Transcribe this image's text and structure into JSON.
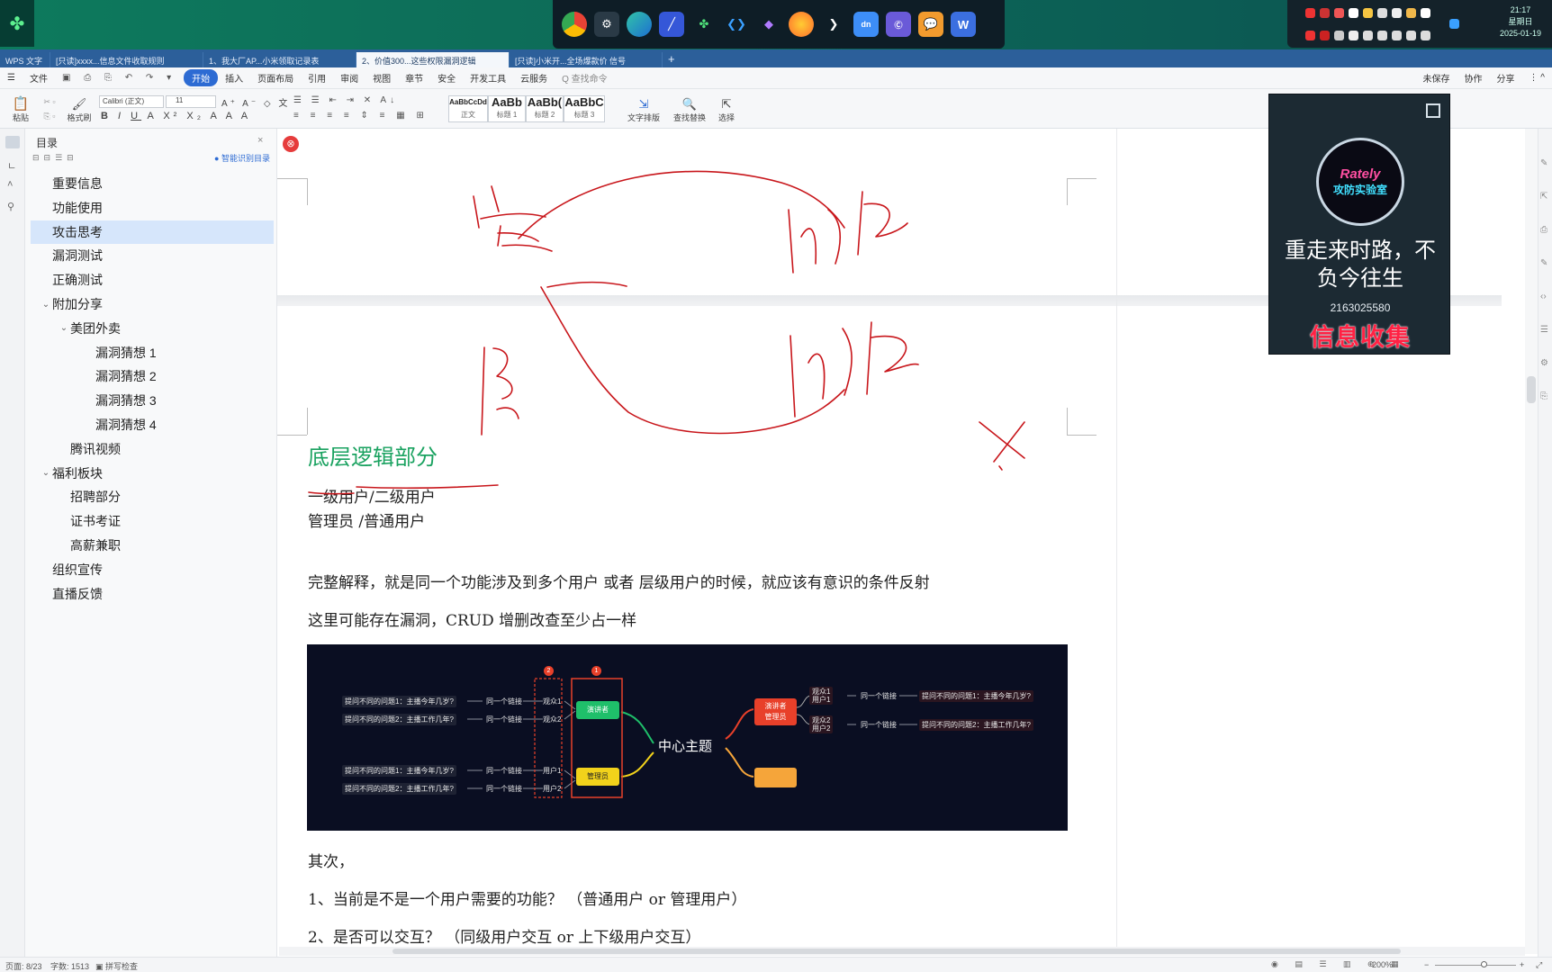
{
  "taskbar": {
    "clock_time": "21:17",
    "clock_weekday": "星期日",
    "clock_date": "2025-01-19"
  },
  "window_tabs": [
    {
      "label": "WPS 文字"
    },
    {
      "label": "[只读]xxxx...信息文件收取规则"
    },
    {
      "label": "1、我大厂AP...小米领取记录表"
    },
    {
      "label": "2、价值300...这些权限漏洞逻辑"
    },
    {
      "label": "[只读]小米开...全场爆款价 信号"
    }
  ],
  "menu": {
    "items": [
      "文件",
      "开始",
      "插入",
      "页面布局",
      "引用",
      "审阅",
      "视图",
      "章节",
      "安全",
      "开发工具",
      "云服务",
      "Q 查找命令"
    ],
    "right": [
      "未保存",
      "协作",
      "分享"
    ]
  },
  "ribbon": {
    "paste": "粘贴",
    "format_painter": "格式刷",
    "font_name": "Calibri (正文)",
    "font_size": "11",
    "styles": [
      {
        "sample": "AaBbCcDd",
        "name": "正文"
      },
      {
        "sample": "AaBb",
        "name": "标题 1"
      },
      {
        "sample": "AaBb(",
        "name": "标题 2"
      },
      {
        "sample": "AaBbC",
        "name": "标题 3"
      }
    ],
    "text_tools": "文字排版",
    "find_replace": "查找替换",
    "select": "选择"
  },
  "sidebar": {
    "title": "目录",
    "smart_toc": "智能识别目录",
    "items": [
      {
        "label": "重要信息",
        "level": 0,
        "chevron": ""
      },
      {
        "label": "功能使用",
        "level": 0,
        "chevron": ""
      },
      {
        "label": "攻击思考",
        "level": 0,
        "chevron": "",
        "selected": true
      },
      {
        "label": "漏洞测试",
        "level": 0,
        "chevron": ""
      },
      {
        "label": "正确测试",
        "level": 0,
        "chevron": ""
      },
      {
        "label": "附加分享",
        "level": 0,
        "chevron": "v"
      },
      {
        "label": "美团外卖",
        "level": 1,
        "chevron": "v"
      },
      {
        "label": "漏洞猜想 1",
        "level": 2,
        "chevron": ""
      },
      {
        "label": "漏洞猜想 2",
        "level": 2,
        "chevron": ""
      },
      {
        "label": "漏洞猜想 3",
        "level": 2,
        "chevron": ""
      },
      {
        "label": "漏洞猜想 4",
        "level": 2,
        "chevron": ""
      },
      {
        "label": "腾讯视频",
        "level": 1,
        "chevron": ""
      },
      {
        "label": "福利板块",
        "level": 0,
        "chevron": "v"
      },
      {
        "label": "招聘部分",
        "level": 1,
        "chevron": ""
      },
      {
        "label": "证书考证",
        "level": 1,
        "chevron": ""
      },
      {
        "label": "高薪兼职",
        "level": 1,
        "chevron": ""
      },
      {
        "label": "组织宣传",
        "level": 0,
        "chevron": ""
      },
      {
        "label": "直播反馈",
        "level": 0,
        "chevron": ""
      }
    ]
  },
  "document": {
    "heading": "底层逻辑部分",
    "line1": "一级用户/二级用户",
    "line2": "管理员  /普通用户",
    "para1": "完整解释，就是同一个功能涉及到多个用户 或者 层级用户的时候，就应该有意识的条件反射",
    "para2": "这里可能存在漏洞，CRUD 增删改查至少占一样",
    "para3": "其次，",
    "para4": "1、当前是不是一个用户需要的功能？  （普通用户  or  管理用户）",
    "para5": "2、是否可以交互？   （同级用户交互 or  上下级用户交互）"
  },
  "mindmap": {
    "center": "中心主题",
    "left_nodes": [
      "演讲者",
      "管理员"
    ],
    "left_mid": [
      "观众1",
      "观众2",
      "用户1",
      "用户2"
    ],
    "left_links": [
      "同一个链接",
      "同一个链接",
      "同一个链接",
      "同一个链接"
    ],
    "left_questions": [
      "提问不同的问题1：主播今年几岁?",
      "提问不同的问题2：主播工作几年?",
      "提问不同的问题1：主播今年几岁?",
      "提问不同的问题2：主播工作几年?"
    ],
    "badges": [
      "2",
      "1"
    ],
    "right_node": "演讲者\n管理员",
    "right_mid": [
      "观众1\n用户1",
      "观众2\n用户2"
    ],
    "right_links": [
      "同一个链接",
      "同一个链接"
    ],
    "right_questions": [
      "提问不同的问题1：主播今年几岁?",
      "提问不同的问题2：主播工作几年?"
    ],
    "colors": {
      "green": "#1fbf6a",
      "yellow": "#f2d21b",
      "red": "#e8402a",
      "orange": "#f5a53a",
      "bg": "#0a0e22"
    }
  },
  "overlay_card": {
    "logo_line1": "Rately",
    "logo_line2": "攻防实验室",
    "slogan": "重走来时路，不负今往生",
    "qq": "2163025580",
    "tag": "信息收集"
  },
  "statusbar": {
    "page": "页面: 8/23",
    "words": "字数: 1513",
    "spell": "拼写检查",
    "zoom": "200%"
  }
}
